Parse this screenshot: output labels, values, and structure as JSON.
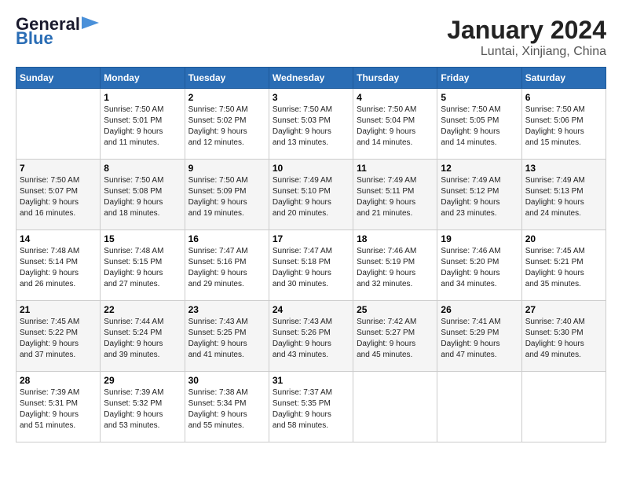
{
  "logo": {
    "line1": "General",
    "line2": "Blue"
  },
  "title": "January 2024",
  "subtitle": "Luntai, Xinjiang, China",
  "weekdays": [
    "Sunday",
    "Monday",
    "Tuesday",
    "Wednesday",
    "Thursday",
    "Friday",
    "Saturday"
  ],
  "weeks": [
    [
      {
        "day": "",
        "info": ""
      },
      {
        "day": "1",
        "info": "Sunrise: 7:50 AM\nSunset: 5:01 PM\nDaylight: 9 hours\nand 11 minutes."
      },
      {
        "day": "2",
        "info": "Sunrise: 7:50 AM\nSunset: 5:02 PM\nDaylight: 9 hours\nand 12 minutes."
      },
      {
        "day": "3",
        "info": "Sunrise: 7:50 AM\nSunset: 5:03 PM\nDaylight: 9 hours\nand 13 minutes."
      },
      {
        "day": "4",
        "info": "Sunrise: 7:50 AM\nSunset: 5:04 PM\nDaylight: 9 hours\nand 14 minutes."
      },
      {
        "day": "5",
        "info": "Sunrise: 7:50 AM\nSunset: 5:05 PM\nDaylight: 9 hours\nand 14 minutes."
      },
      {
        "day": "6",
        "info": "Sunrise: 7:50 AM\nSunset: 5:06 PM\nDaylight: 9 hours\nand 15 minutes."
      }
    ],
    [
      {
        "day": "7",
        "info": "Sunrise: 7:50 AM\nSunset: 5:07 PM\nDaylight: 9 hours\nand 16 minutes."
      },
      {
        "day": "8",
        "info": "Sunrise: 7:50 AM\nSunset: 5:08 PM\nDaylight: 9 hours\nand 18 minutes."
      },
      {
        "day": "9",
        "info": "Sunrise: 7:50 AM\nSunset: 5:09 PM\nDaylight: 9 hours\nand 19 minutes."
      },
      {
        "day": "10",
        "info": "Sunrise: 7:49 AM\nSunset: 5:10 PM\nDaylight: 9 hours\nand 20 minutes."
      },
      {
        "day": "11",
        "info": "Sunrise: 7:49 AM\nSunset: 5:11 PM\nDaylight: 9 hours\nand 21 minutes."
      },
      {
        "day": "12",
        "info": "Sunrise: 7:49 AM\nSunset: 5:12 PM\nDaylight: 9 hours\nand 23 minutes."
      },
      {
        "day": "13",
        "info": "Sunrise: 7:49 AM\nSunset: 5:13 PM\nDaylight: 9 hours\nand 24 minutes."
      }
    ],
    [
      {
        "day": "14",
        "info": "Sunrise: 7:48 AM\nSunset: 5:14 PM\nDaylight: 9 hours\nand 26 minutes."
      },
      {
        "day": "15",
        "info": "Sunrise: 7:48 AM\nSunset: 5:15 PM\nDaylight: 9 hours\nand 27 minutes."
      },
      {
        "day": "16",
        "info": "Sunrise: 7:47 AM\nSunset: 5:16 PM\nDaylight: 9 hours\nand 29 minutes."
      },
      {
        "day": "17",
        "info": "Sunrise: 7:47 AM\nSunset: 5:18 PM\nDaylight: 9 hours\nand 30 minutes."
      },
      {
        "day": "18",
        "info": "Sunrise: 7:46 AM\nSunset: 5:19 PM\nDaylight: 9 hours\nand 32 minutes."
      },
      {
        "day": "19",
        "info": "Sunrise: 7:46 AM\nSunset: 5:20 PM\nDaylight: 9 hours\nand 34 minutes."
      },
      {
        "day": "20",
        "info": "Sunrise: 7:45 AM\nSunset: 5:21 PM\nDaylight: 9 hours\nand 35 minutes."
      }
    ],
    [
      {
        "day": "21",
        "info": "Sunrise: 7:45 AM\nSunset: 5:22 PM\nDaylight: 9 hours\nand 37 minutes."
      },
      {
        "day": "22",
        "info": "Sunrise: 7:44 AM\nSunset: 5:24 PM\nDaylight: 9 hours\nand 39 minutes."
      },
      {
        "day": "23",
        "info": "Sunrise: 7:43 AM\nSunset: 5:25 PM\nDaylight: 9 hours\nand 41 minutes."
      },
      {
        "day": "24",
        "info": "Sunrise: 7:43 AM\nSunset: 5:26 PM\nDaylight: 9 hours\nand 43 minutes."
      },
      {
        "day": "25",
        "info": "Sunrise: 7:42 AM\nSunset: 5:27 PM\nDaylight: 9 hours\nand 45 minutes."
      },
      {
        "day": "26",
        "info": "Sunrise: 7:41 AM\nSunset: 5:29 PM\nDaylight: 9 hours\nand 47 minutes."
      },
      {
        "day": "27",
        "info": "Sunrise: 7:40 AM\nSunset: 5:30 PM\nDaylight: 9 hours\nand 49 minutes."
      }
    ],
    [
      {
        "day": "28",
        "info": "Sunrise: 7:39 AM\nSunset: 5:31 PM\nDaylight: 9 hours\nand 51 minutes."
      },
      {
        "day": "29",
        "info": "Sunrise: 7:39 AM\nSunset: 5:32 PM\nDaylight: 9 hours\nand 53 minutes."
      },
      {
        "day": "30",
        "info": "Sunrise: 7:38 AM\nSunset: 5:34 PM\nDaylight: 9 hours\nand 55 minutes."
      },
      {
        "day": "31",
        "info": "Sunrise: 7:37 AM\nSunset: 5:35 PM\nDaylight: 9 hours\nand 58 minutes."
      },
      {
        "day": "",
        "info": ""
      },
      {
        "day": "",
        "info": ""
      },
      {
        "day": "",
        "info": ""
      }
    ]
  ]
}
